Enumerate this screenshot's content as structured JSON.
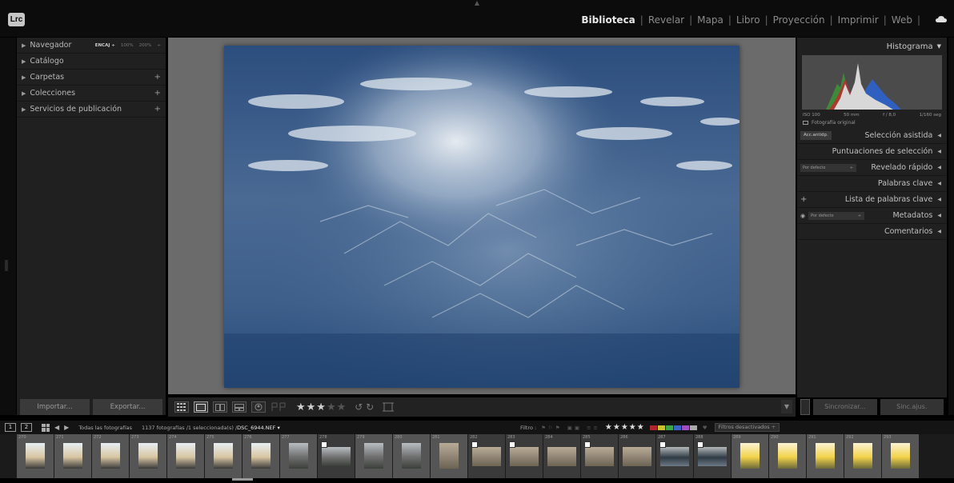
{
  "app": {
    "logo_text": "Lrc"
  },
  "modules": {
    "items": [
      "Biblioteca",
      "Revelar",
      "Mapa",
      "Libro",
      "Proyección",
      "Imprimir",
      "Web"
    ],
    "active": "Biblioteca",
    "separator": "|"
  },
  "left_panel": {
    "navigator": {
      "label": "Navegador",
      "options": [
        "ENCAJ ÷",
        "100%",
        "200%",
        "÷"
      ]
    },
    "sections": [
      {
        "label": "Catálogo",
        "has_plus": false
      },
      {
        "label": "Carpetas",
        "has_plus": true
      },
      {
        "label": "Colecciones",
        "has_plus": true
      },
      {
        "label": "Servicios de publicación",
        "has_plus": true
      }
    ],
    "plus_symbol": "+",
    "import_label": "Importar...",
    "export_label": "Exportar..."
  },
  "toolbar": {
    "stars_filled": "★★★",
    "stars_empty": "★★",
    "arrows": "↺ ↻"
  },
  "right_panel": {
    "histogram": {
      "title": "Histograma",
      "iso": "ISO 100",
      "focal": "50 mm",
      "aperture": "f / 8,0",
      "shutter": "1/160 seg",
      "original": "Fotografía original"
    },
    "sections": [
      {
        "label": "Selección asistida",
        "control": "Acc.antidp."
      },
      {
        "label": "Puntuaciones de selección"
      },
      {
        "label": "Revelado rápido",
        "select": "Por defecto"
      },
      {
        "label": "Palabras clave"
      },
      {
        "label": "Lista de palabras clave",
        "plus": "+"
      },
      {
        "label": "Metadatos",
        "select": "Por defecto"
      },
      {
        "label": "Comentarios"
      }
    ],
    "sync_label": "Sincronizar...",
    "sync_settings_label": "Sinc.ajus."
  },
  "filmstrip_bar": {
    "page1": "1",
    "page2": "2",
    "source": "Todas las fotografías",
    "count": "1137 fotografías /1 seleccionada(s) /",
    "file": "DSC_6944.NEF ▾",
    "filter_label": "Filtro :",
    "filter_stars": "★★★★★",
    "filters_off": "Filtros desactivados ÷"
  },
  "filmstrip": {
    "items": [
      {
        "idx": "270",
        "kind": "portrait",
        "badge": false,
        "tone": "beach"
      },
      {
        "idx": "271",
        "kind": "portrait",
        "badge": false,
        "tone": "beach"
      },
      {
        "idx": "272",
        "kind": "portrait",
        "badge": false,
        "tone": "beach"
      },
      {
        "idx": "273",
        "kind": "portrait",
        "badge": false,
        "tone": "beach"
      },
      {
        "idx": "274",
        "kind": "portrait",
        "badge": false,
        "tone": "beach"
      },
      {
        "idx": "275",
        "kind": "portrait",
        "badge": false,
        "tone": "beach"
      },
      {
        "idx": "276",
        "kind": "portrait",
        "badge": false,
        "tone": "beach"
      },
      {
        "idx": "277",
        "kind": "portrait",
        "badge": false,
        "tone": "street"
      },
      {
        "idx": "278",
        "kind": "landscape",
        "badge": true,
        "tone": "street"
      },
      {
        "idx": "279",
        "kind": "portrait",
        "badge": false,
        "tone": "street"
      },
      {
        "idx": "280",
        "kind": "portrait",
        "badge": false,
        "tone": "street"
      },
      {
        "idx": "281",
        "kind": "portrait",
        "badge": false,
        "tone": "rock"
      },
      {
        "idx": "282",
        "kind": "landscape",
        "badge": true,
        "tone": "rock"
      },
      {
        "idx": "283",
        "kind": "landscape",
        "badge": true,
        "tone": "rock"
      },
      {
        "idx": "284",
        "kind": "landscape",
        "badge": false,
        "tone": "rock"
      },
      {
        "idx": "285",
        "kind": "landscape",
        "badge": true,
        "tone": "rock"
      },
      {
        "idx": "286",
        "kind": "landscape",
        "badge": false,
        "tone": "rock"
      },
      {
        "idx": "287",
        "kind": "landscape",
        "badge": true,
        "tone": "market"
      },
      {
        "idx": "288",
        "kind": "landscape",
        "badge": true,
        "tone": "market"
      },
      {
        "idx": "289",
        "kind": "portrait",
        "badge": false,
        "tone": "sunny"
      },
      {
        "idx": "290",
        "kind": "portrait",
        "badge": false,
        "tone": "sunny"
      },
      {
        "idx": "291",
        "kind": "portrait",
        "badge": false,
        "tone": "sunny"
      },
      {
        "idx": "292",
        "kind": "portrait",
        "badge": false,
        "tone": "sunny"
      },
      {
        "idx": "293",
        "kind": "portrait",
        "badge": false,
        "tone": "sunny"
      }
    ]
  },
  "colors": {
    "accent_swatches": [
      "#b0252d",
      "#c7c22e",
      "#3aa84a",
      "#3c63c7",
      "#a04fc0",
      "#aaaaaa"
    ]
  }
}
